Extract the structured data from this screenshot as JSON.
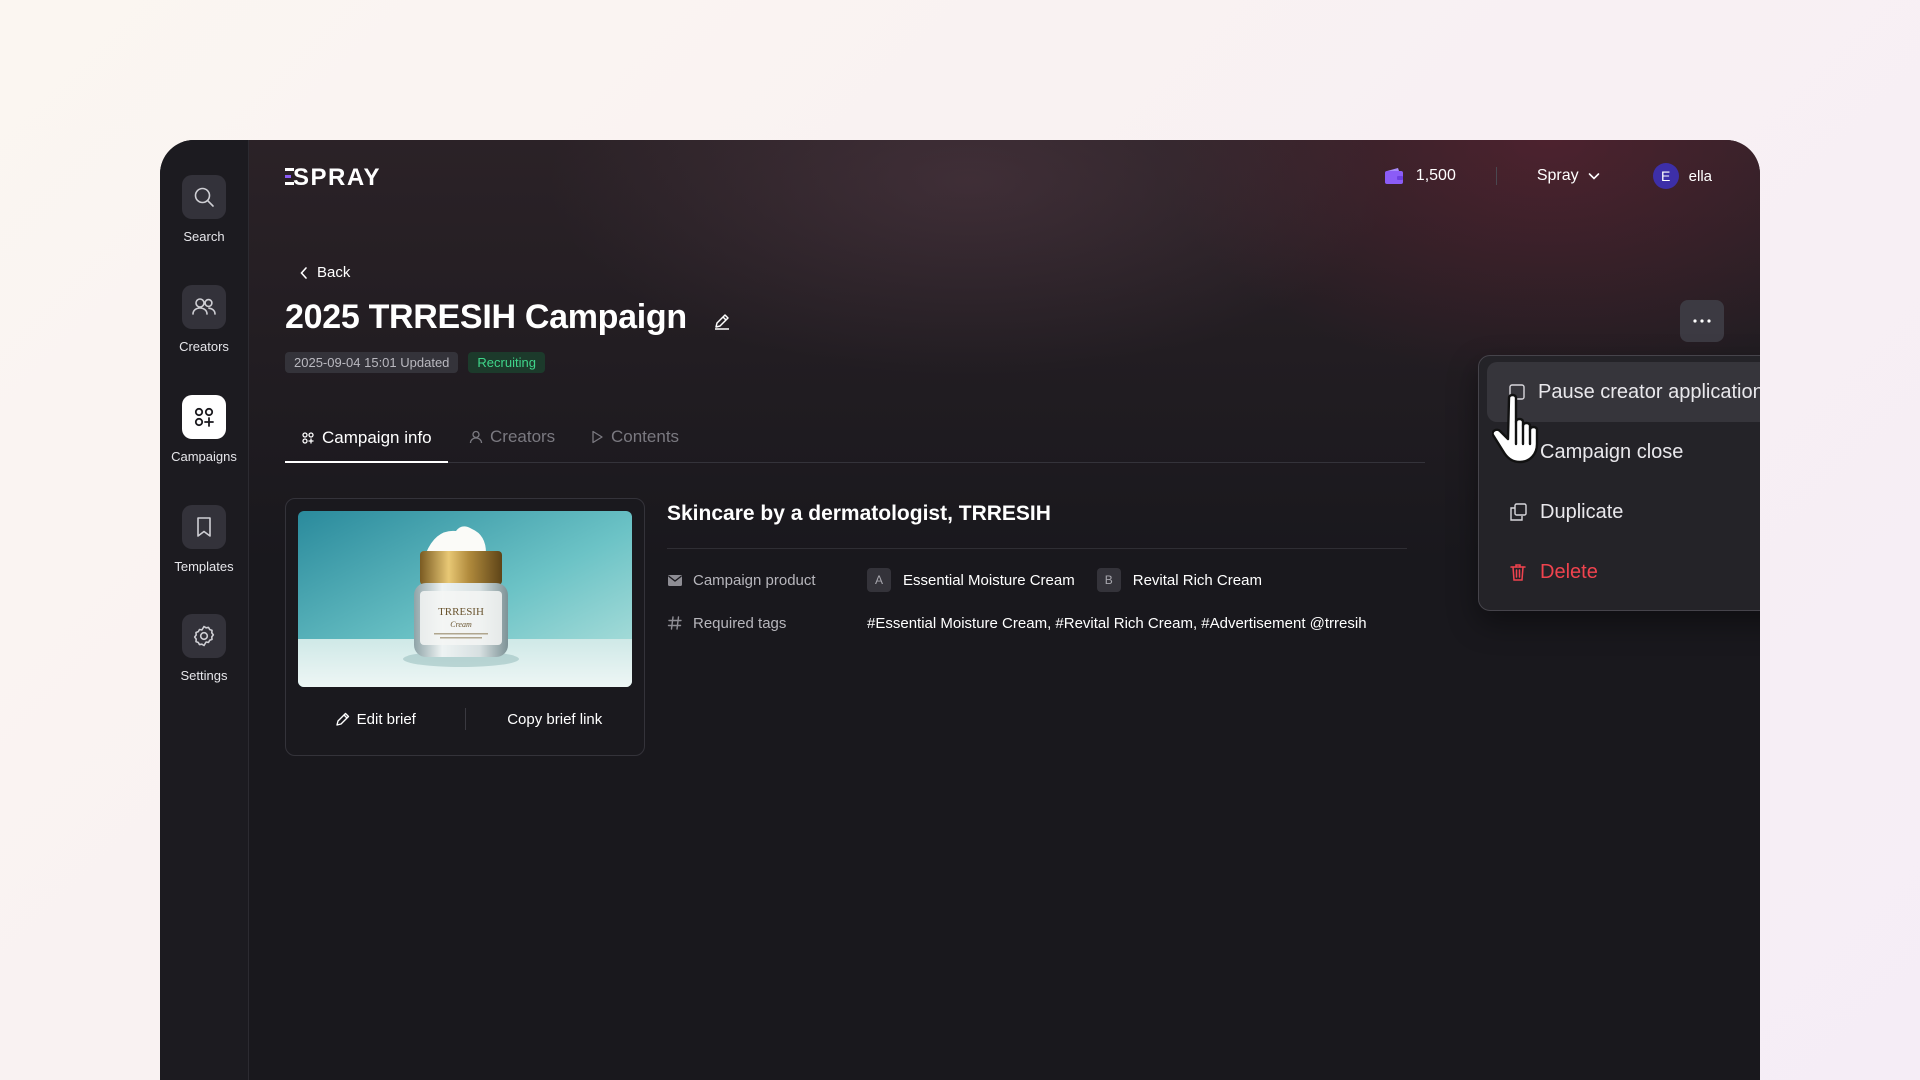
{
  "brand": {
    "name": "SPRAY"
  },
  "sidebar": {
    "items": [
      {
        "label": "Search",
        "icon": "search-icon"
      },
      {
        "label": "Creators",
        "icon": "users-icon"
      },
      {
        "label": "Campaigns",
        "icon": "grid-plus-icon",
        "active": true
      },
      {
        "label": "Templates",
        "icon": "bookmark-icon"
      },
      {
        "label": "Settings",
        "icon": "gear-icon"
      }
    ]
  },
  "header": {
    "credits": "1,500",
    "workspace": "Spray",
    "user": {
      "initial": "E",
      "name": "ella"
    }
  },
  "page": {
    "back_label": "Back",
    "title": "2025 TRRESIH Campaign",
    "updated": "2025-09-04 15:01 Updated",
    "status": "Recruiting"
  },
  "tabs": [
    {
      "label": "Campaign info",
      "active": true
    },
    {
      "label": "Creators",
      "active": false
    },
    {
      "label": "Contents",
      "active": false
    }
  ],
  "brief": {
    "image_text": {
      "brand": "TRRESIH",
      "product": "Cream"
    },
    "edit_label": "Edit brief",
    "copy_label": "Copy brief link"
  },
  "details": {
    "title": "Skincare by a dermatologist, TRRESIH",
    "product_label": "Campaign product",
    "products": [
      {
        "badge": "A",
        "name": "Essential Moisture Cream"
      },
      {
        "badge": "B",
        "name": "Revital Rich Cream"
      }
    ],
    "tags_label": "Required tags",
    "tags_value": "#Essential Moisture Cream, #Revital Rich Cream, #Advertisement @trresih"
  },
  "menu": {
    "items": [
      {
        "label": "Pause creator applications",
        "icon": "checkbox-icon",
        "hover": true
      },
      {
        "label": "Campaign close",
        "icon": "minus-circle-icon"
      },
      {
        "label": "Duplicate",
        "icon": "duplicate-icon"
      },
      {
        "label": "Delete",
        "icon": "trash-icon",
        "danger": true
      }
    ]
  },
  "colors": {
    "accent_purple": "#8b5cf6",
    "status_green": "#3fd58a",
    "danger_red": "#f0434e",
    "avatar": "#3d2fa8"
  }
}
